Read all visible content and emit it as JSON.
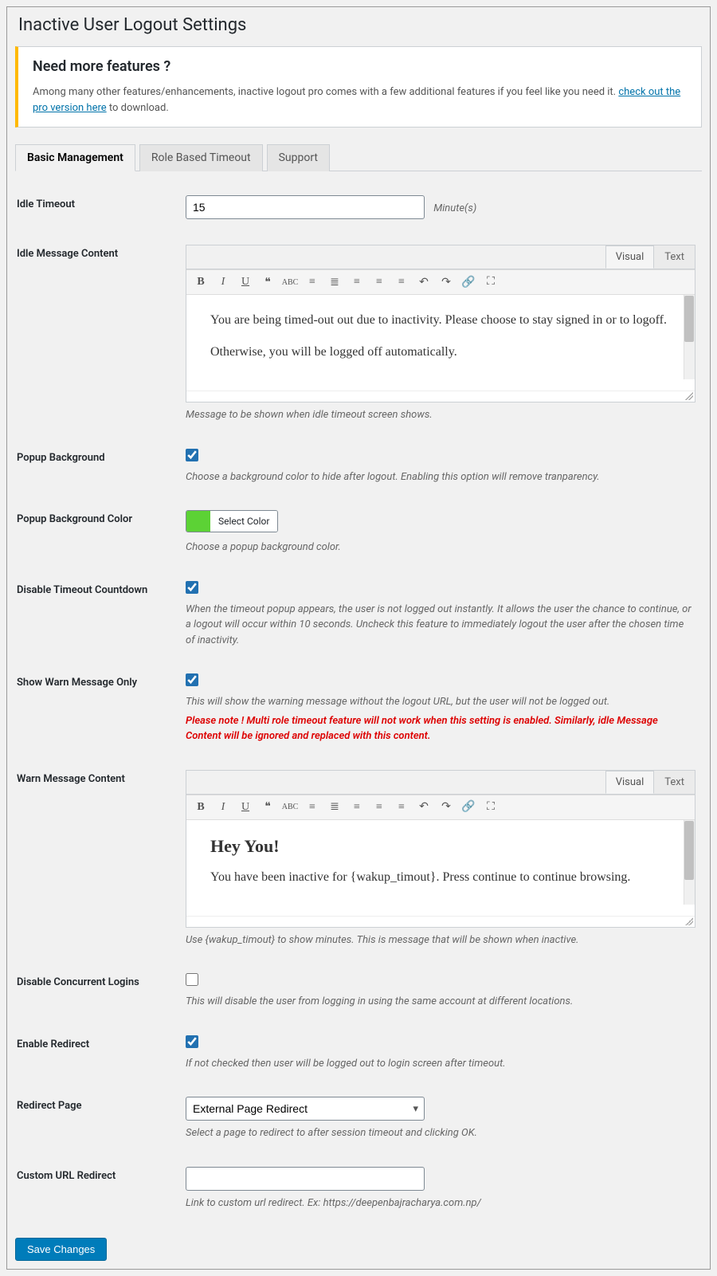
{
  "page_title": "Inactive User Logout Settings",
  "notice": {
    "heading": "Need more features ?",
    "text_before": "Among many other features/enhancements, inactive logout pro comes with a few additional features if you feel like you need it. ",
    "link": "check out the pro version here",
    "text_after": " to download."
  },
  "tabs": [
    "Basic Management",
    "Role Based Timeout",
    "Support"
  ],
  "labels": {
    "idle_timeout": "Idle Timeout",
    "idle_msg": "Idle Message Content",
    "popup_bg": "Popup Background",
    "popup_bg_color": "Popup Background Color",
    "disable_countdown": "Disable Timeout Countdown",
    "warn_only": "Show Warn Message Only",
    "warn_msg": "Warn Message Content",
    "concurrent": "Disable Concurrent Logins",
    "enable_redirect": "Enable Redirect",
    "redirect_page": "Redirect Page",
    "custom_url": "Custom URL Redirect"
  },
  "values": {
    "idle_timeout": "15",
    "minute_unit": "Minute(s)",
    "idle_content_line1": "You are being timed-out out due to inactivity. Please choose to stay signed in or to logoff.",
    "idle_content_line2": "Otherwise, you will be logged off automatically.",
    "warn_heading": "Hey You!",
    "warn_content": "You have been inactive for {wakup_timout}. Press continue to continue browsing.",
    "redirect_page": "External Page Redirect",
    "custom_url": "",
    "color_label": "Select Color"
  },
  "desc": {
    "idle_msg": "Message to be shown when idle timeout screen shows.",
    "popup_bg": "Choose a background color to hide after logout. Enabling this option will remove tranparency.",
    "popup_bg_color": "Choose a popup background color.",
    "countdown": "When the timeout popup appears, the user is not logged out instantly. It allows the user the chance to continue, or a logout will occur within 10 seconds. Uncheck this feature to immediately logout the user after the chosen time of inactivity.",
    "warn_only": "This will show the warning message without the logout URL, but the user will not be logged out.",
    "warn_only_red": "Please note ! Multi role timeout feature will not work when this setting is enabled. Similarly, idle Message Content will be ignored and replaced with this content.",
    "warn_msg": "Use {wakup_timout} to show minutes. This is message that will be shown when inactive.",
    "concurrent": "This will disable the user from logging in using the same account at different locations.",
    "enable_redirect": "If not checked then user will be logged out to login screen after timeout.",
    "redirect_page": "Select a page to redirect to after session timeout and clicking OK.",
    "custom_url": "Link to custom url redirect. Ex: https://deepenbajracharya.com.np/"
  },
  "editor_tabs": {
    "visual": "Visual",
    "text": "Text"
  },
  "save": "Save Changes"
}
